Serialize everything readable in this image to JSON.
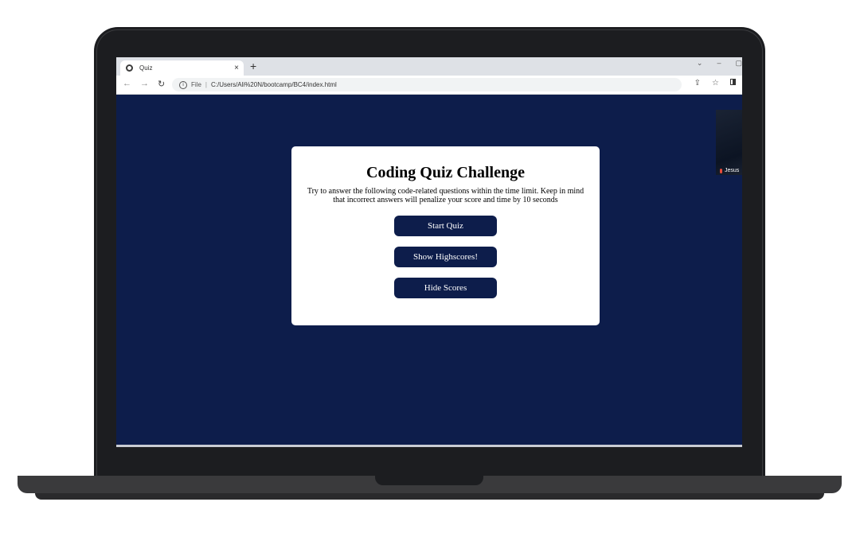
{
  "browser": {
    "tab_title": "Quiz",
    "tab_close": "×",
    "new_tab": "+",
    "url_file_label": "File",
    "url_path": "C:/Users/Ali%20N/bootcamp/BC4/index.html"
  },
  "video_call": {
    "participant_name": "Jesus"
  },
  "quiz": {
    "title": "Coding Quiz Challenge",
    "description": "Try to answer the following code-related questions within the time limit. Keep in mind that incorrect answers will penalize your score and time by 10 seconds",
    "buttons": {
      "start": "Start Quiz",
      "show_highscores": "Show Highscores!",
      "hide_scores": "Hide Scores"
    }
  },
  "colors": {
    "page_background": "#0d1d4b",
    "button_background": "#0d1d4b",
    "card_background": "#ffffff"
  }
}
